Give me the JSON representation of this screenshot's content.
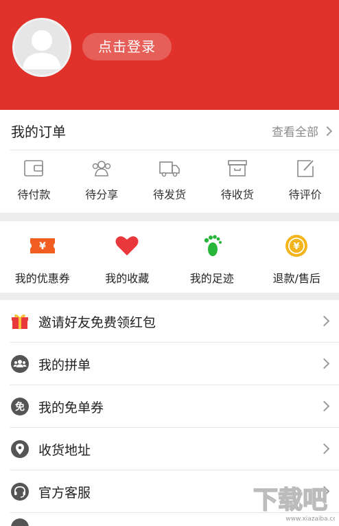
{
  "header": {
    "login_label": "点击登录",
    "bg_color": "#e0322b"
  },
  "orders": {
    "title": "我的订单",
    "view_all": "查看全部",
    "items": [
      {
        "label": "待付款",
        "icon": "wallet-icon"
      },
      {
        "label": "待分享",
        "icon": "share-people-icon"
      },
      {
        "label": "待发货",
        "icon": "truck-icon"
      },
      {
        "label": "待收货",
        "icon": "box-icon"
      },
      {
        "label": "待评价",
        "icon": "edit-icon"
      }
    ]
  },
  "quick": {
    "items": [
      {
        "label": "我的优惠券",
        "icon": "coupon-icon",
        "color": "#f25d22"
      },
      {
        "label": "我的收藏",
        "icon": "heart-icon",
        "color": "#e8383b"
      },
      {
        "label": "我的足迹",
        "icon": "footprint-icon",
        "color": "#27b53a"
      },
      {
        "label": "退款/售后",
        "icon": "refund-coin-icon",
        "color": "#f4b51c"
      }
    ]
  },
  "menu": {
    "items": [
      {
        "label": "邀请好友免费领红包",
        "icon": "gift-icon"
      },
      {
        "label": "我的拼单",
        "icon": "group-icon"
      },
      {
        "label": "我的免单券",
        "icon": "free-coupon-icon",
        "glyph": "免"
      },
      {
        "label": "收货地址",
        "icon": "location-icon"
      },
      {
        "label": "官方客服",
        "icon": "headset-icon"
      }
    ]
  },
  "watermark": {
    "text": "下载吧",
    "url_text": "www.xiazaiba.com"
  }
}
